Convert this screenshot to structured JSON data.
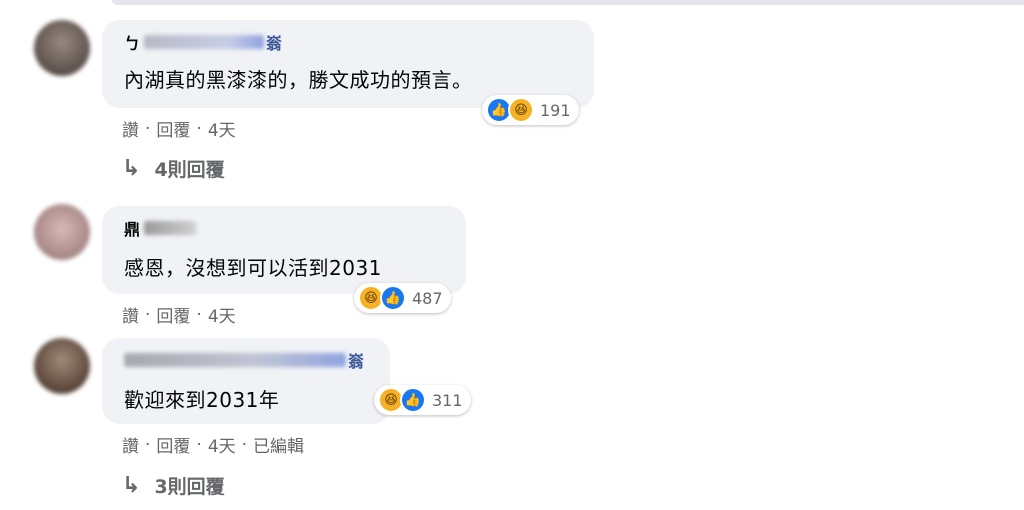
{
  "comments": [
    {
      "name_visible_start": "ㄅ",
      "name_visible_end": "嵡",
      "text": "內湖真的黑漆漆的，勝文成功的預言。",
      "reaction_count": "191",
      "actions": {
        "like": "讚",
        "reply": "回覆",
        "time": "4天"
      },
      "replies_label": "4則回覆"
    },
    {
      "name_visible_start": "鼎",
      "name_visible_end": "",
      "text": "感恩，沒想到可以活到2031",
      "reaction_count": "487",
      "actions": {
        "like": "讚",
        "reply": "回覆",
        "time": "4天"
      },
      "replies_label": ""
    },
    {
      "name_visible_start": "",
      "name_visible_end": "嵡",
      "text": "歡迎來到2031年",
      "reaction_count": "311",
      "actions": {
        "like": "讚",
        "reply": "回覆",
        "time": "4天",
        "edited": "已編輯"
      },
      "replies_label": "3則回覆"
    }
  ],
  "separator": "·",
  "icons": {
    "like": "thumbs-up-icon",
    "haha": "laugh-icon",
    "reply_arrow": "reply-arrow-icon"
  },
  "colors": {
    "like": "#1877f2",
    "haha": "#f7b125",
    "bubble": "#f0f2f5",
    "meta": "#65676b"
  }
}
